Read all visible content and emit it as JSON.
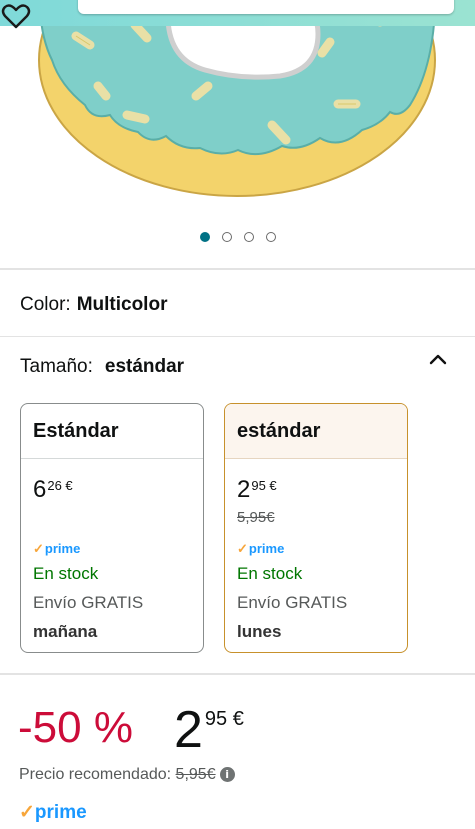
{
  "image": {
    "pagination": {
      "total": 4,
      "active": 0
    }
  },
  "color": {
    "label": "Color:",
    "value": "Multicolor"
  },
  "size": {
    "label": "Tamaño:",
    "value": "estándar"
  },
  "options": [
    {
      "title": "Estándar",
      "price_whole": "6",
      "price_frac": "26 €",
      "list_price": "",
      "prime": "prime",
      "stock": "En stock",
      "shipping": "Envío GRATIS",
      "delivery": "mañana"
    },
    {
      "title": "estándar",
      "price_whole": "2",
      "price_frac": "95 €",
      "list_price": "5,95€",
      "prime": "prime",
      "stock": "En stock",
      "shipping": "Envío GRATIS",
      "delivery": "lunes"
    }
  ],
  "buybox": {
    "discount": "-50 %",
    "price_whole": "2",
    "price_frac": "95 €",
    "rrp_label": "Precio recomendado:",
    "rrp_value": "5,95€",
    "info_icon": "i",
    "prime": "prime"
  },
  "colors": {
    "accent": "#007185",
    "deal": "#cc0c39",
    "stock": "#007600",
    "prime": "#1a98ff",
    "selected_border": "#c7912c"
  }
}
